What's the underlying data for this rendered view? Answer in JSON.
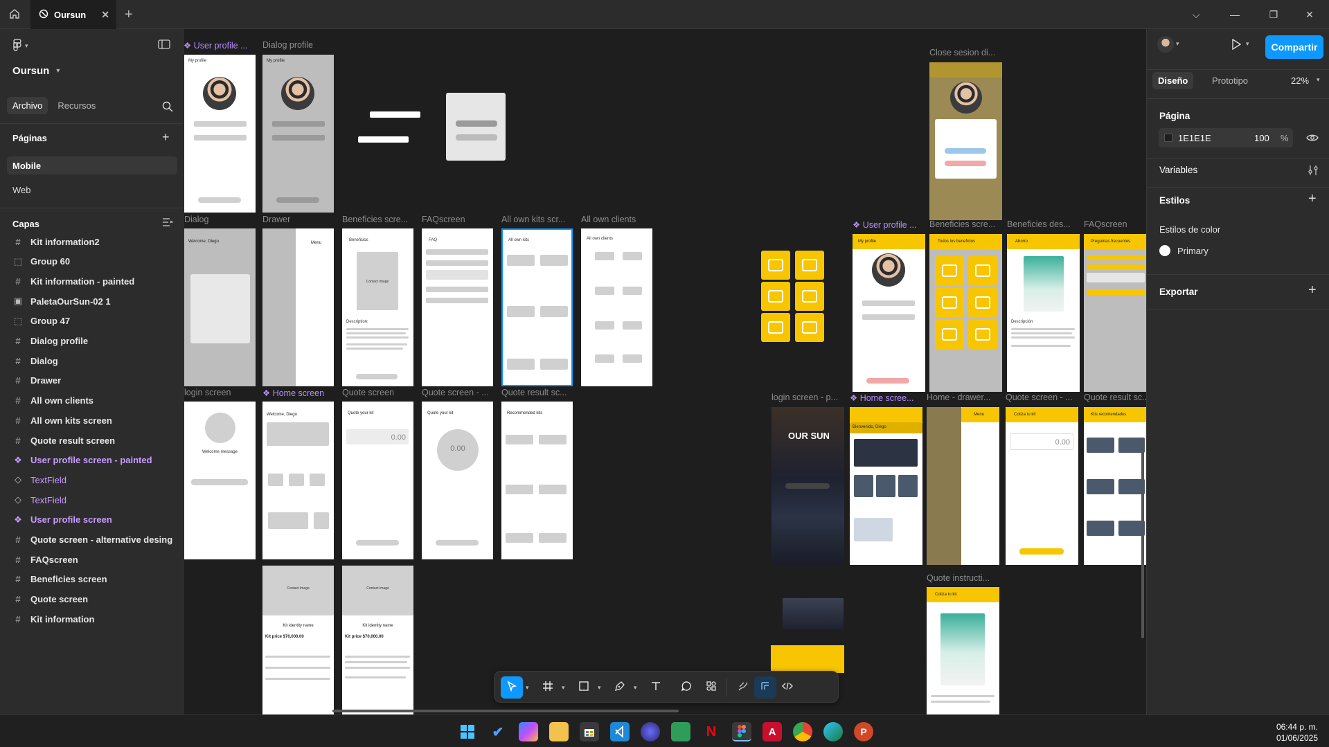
{
  "window": {
    "tab_title": "Oursun",
    "close_glyph": "✕",
    "new_tab_glyph": "+",
    "controls": {
      "dropdown": "⌵",
      "minimize": "—",
      "maximize": "❐",
      "close": "✕"
    }
  },
  "left_panel": {
    "file_name": "Oursun",
    "tabs": [
      {
        "label": "Archivo"
      },
      {
        "label": "Recursos"
      }
    ],
    "pages_header": "Páginas",
    "pages": [
      {
        "label": "Mobile"
      },
      {
        "label": "Web"
      }
    ],
    "layers_header": "Capas",
    "layers": [
      {
        "label": "Kit information2",
        "icon": "frame-icon"
      },
      {
        "label": "Group 60",
        "icon": "group-icon"
      },
      {
        "label": "Kit information - painted",
        "icon": "frame-icon"
      },
      {
        "label": "PaletaOurSun-02 1",
        "icon": "image-icon"
      },
      {
        "label": "Group 47",
        "icon": "group-icon"
      },
      {
        "label": "Dialog profile",
        "icon": "frame-icon"
      },
      {
        "label": "Dialog",
        "icon": "frame-icon"
      },
      {
        "label": "Drawer",
        "icon": "frame-icon"
      },
      {
        "label": "All own clients",
        "icon": "frame-icon"
      },
      {
        "label": "All own kits screen",
        "icon": "frame-icon"
      },
      {
        "label": "Quote result screen",
        "icon": "frame-icon"
      },
      {
        "label": "User profile screen - painted",
        "icon": "component-icon"
      },
      {
        "label": "TextField",
        "icon": "instance-icon"
      },
      {
        "label": "TextField",
        "icon": "instance-icon"
      },
      {
        "label": "User profile screen",
        "icon": "component-icon"
      },
      {
        "label": "Quote screen - alternative desing",
        "icon": "frame-icon"
      },
      {
        "label": "FAQscreen",
        "icon": "frame-icon"
      },
      {
        "label": "Beneficies screen",
        "icon": "frame-icon"
      },
      {
        "label": "Quote screen",
        "icon": "frame-icon"
      },
      {
        "label": "Kit information",
        "icon": "frame-icon"
      }
    ]
  },
  "canvas": {
    "labels": {
      "user_profile": "User profile ...",
      "dialog_profile": "Dialog profile",
      "close_session": "Close sesion di...",
      "dialog": "Dialog",
      "drawer": "Drawer",
      "beneficies": "Beneficies scre...",
      "faq": "FAQscreen",
      "all_kits": "All own kits scr...",
      "all_clients": "All own clients",
      "user_profile_2": "User profile ...",
      "beneficies_2": "Beneficies scre...",
      "beneficies_des": "Beneficies des...",
      "faq_2": "FAQscreen",
      "login": "login screen",
      "home": "Home screen",
      "quote": "Quote screen",
      "quote_alt": "Quote screen - ...",
      "quote_result": "Quote result sc...",
      "login_p": "login screen - p...",
      "home_2": "Home scree...",
      "home_drawer": "Home - drawer...",
      "quote_2": "Quote screen - ...",
      "quote_result_2": "Quote result sc...",
      "quote_instr": "Quote instructi..."
    },
    "mock_text": {
      "my_profile": "My profile",
      "beneficios": "Beneficios",
      "contact_image": "Contact Image",
      "description": "Description:",
      "faq": "FAQ",
      "all_own_kits": "All own kits",
      "all_own_clients": "All own clients",
      "welcome": "Welcome, Diego",
      "welcome_message": "Welcome message",
      "quote_your_kit": "Quote your kit",
      "quote_value": "0.00",
      "recommended": "Recommended kits",
      "kit_name": "Kit identity name",
      "kit_price": "Kit price $70,000.00",
      "our_sun": "OUR SUN",
      "bienvenido": "Bienvenido, Diego",
      "cotiza": "Cotiza tu kit",
      "todos_beneficios": "Todos los beneficios",
      "ahorro": "Ahorro",
      "preguntas": "Preguntas frecuentes",
      "menu": "Menu",
      "kits_recomendados": "Kits recomendados",
      "descripcion": "Descripción"
    }
  },
  "right_panel": {
    "tabs": [
      {
        "label": "Diseño"
      },
      {
        "label": "Prototipo"
      }
    ],
    "zoom": "22%",
    "share": "Compartir",
    "page_section": "Página",
    "page_color": "1E1E1E",
    "page_opacity": "100",
    "percent": "%",
    "variables": "Variables",
    "styles": "Estilos",
    "color_styles": "Estilos de color",
    "primary": "Primary",
    "export": "Exportar"
  },
  "toolbar": {
    "tools": [
      "move-icon",
      "frame-icon",
      "rectangle-icon",
      "pen-icon",
      "text-icon",
      "comment-icon",
      "actions-icon",
      "draw-icon",
      "dev-mode-icon",
      "code-icon"
    ]
  },
  "help": "?",
  "taskbar": {
    "time": "06:44 p. m.",
    "date": "01/06/2025"
  },
  "colors": {
    "accent": "#0d99ff",
    "brand_yellow": "#f7c600",
    "component": "#c79cff"
  }
}
